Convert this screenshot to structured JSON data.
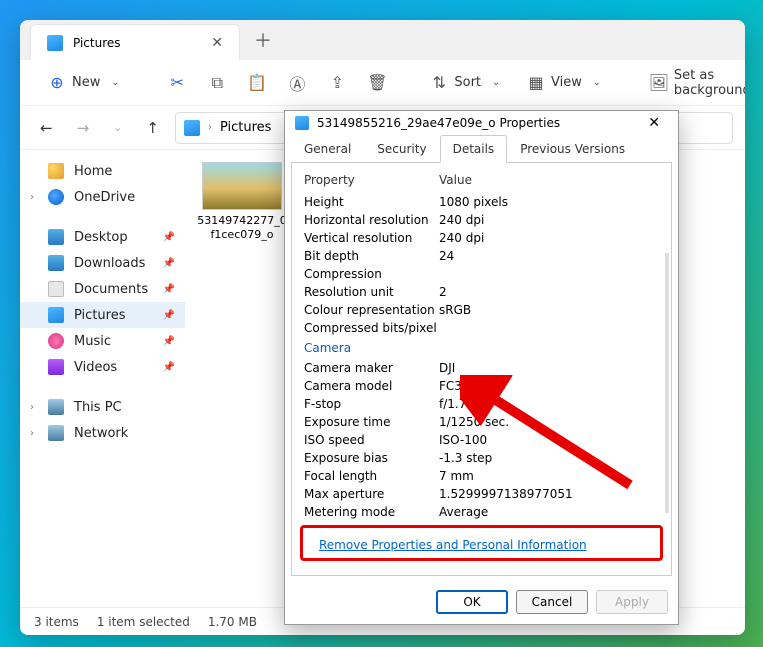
{
  "tab": {
    "title": "Pictures"
  },
  "toolbar": {
    "new": "New",
    "sort": "Sort",
    "view": "View",
    "set_bg": "Set as background"
  },
  "breadcrumb": {
    "current": "Pictures"
  },
  "sidebar": {
    "home": "Home",
    "onedrive": "OneDrive",
    "desktop": "Desktop",
    "downloads": "Downloads",
    "documents": "Documents",
    "pictures": "Pictures",
    "music": "Music",
    "videos": "Videos",
    "thispc": "This PC",
    "network": "Network"
  },
  "thumb": {
    "name": "53149742277_0f1cec079_o"
  },
  "status": {
    "items": "3 items",
    "selected": "1 item selected",
    "size": "1.70 MB"
  },
  "dialog": {
    "title": "53149855216_29ae47e09e_o Properties",
    "tabs": {
      "general": "General",
      "security": "Security",
      "details": "Details",
      "previous": "Previous Versions"
    },
    "header_prop": "Property",
    "header_val": "Value",
    "rows": {
      "height_p": "Height",
      "height_v": "1080 pixels",
      "hres_p": "Horizontal resolution",
      "hres_v": "240 dpi",
      "vres_p": "Vertical resolution",
      "vres_v": "240 dpi",
      "bitdepth_p": "Bit depth",
      "bitdepth_v": "24",
      "compression_p": "Compression",
      "compression_v": "",
      "resunit_p": "Resolution unit",
      "resunit_v": "2",
      "colour_p": "Colour representation",
      "colour_v": "sRGB",
      "cbp_p": "Compressed bits/pixel",
      "cbp_v": "",
      "camera_section": "Camera",
      "maker_p": "Camera maker",
      "maker_v": "DJI",
      "model_p": "Camera model",
      "model_v": "FC3582",
      "fstop_p": "F-stop",
      "fstop_v": "f/1.7",
      "exptime_p": "Exposure time",
      "exptime_v": "1/1250 sec.",
      "iso_p": "ISO speed",
      "iso_v": "ISO-100",
      "expbias_p": "Exposure bias",
      "expbias_v": "-1.3 step",
      "flen_p": "Focal length",
      "flen_v": "7 mm",
      "maxap_p": "Max aperture",
      "maxap_v": "1.5299997138977051",
      "metering_p": "Metering mode",
      "metering_v": "Average"
    },
    "remove_link": "Remove Properties and Personal Information",
    "ok": "OK",
    "cancel": "Cancel",
    "apply": "Apply"
  }
}
